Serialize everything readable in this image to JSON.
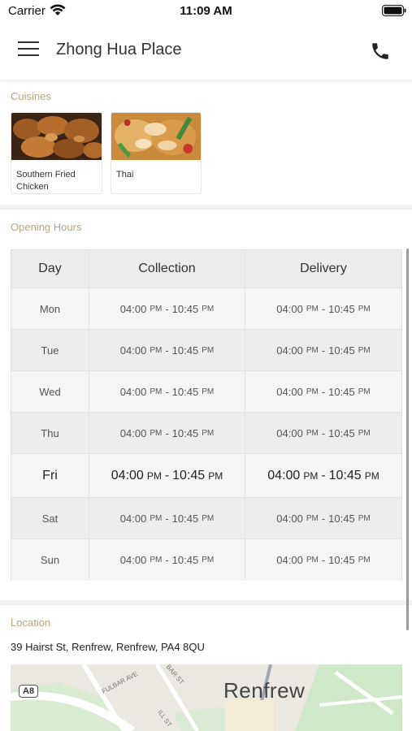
{
  "status_bar": {
    "carrier": "Carrier",
    "time": "11:09 AM"
  },
  "header": {
    "title": "Zhong Hua Place"
  },
  "cuisines": {
    "label": "Cuisines",
    "items": [
      {
        "name": "Southern Fried Chicken"
      },
      {
        "name": "Thai"
      }
    ]
  },
  "opening_hours": {
    "label": "Opening Hours",
    "columns": [
      "Day",
      "Collection",
      "Delivery"
    ],
    "rows": [
      {
        "day": "Mon",
        "collection": {
          "open": "04:00",
          "close": "10:45"
        },
        "delivery": {
          "open": "04:00",
          "close": "10:45"
        }
      },
      {
        "day": "Tue",
        "collection": {
          "open": "04:00",
          "close": "10:45"
        },
        "delivery": {
          "open": "04:00",
          "close": "10:45"
        }
      },
      {
        "day": "Wed",
        "collection": {
          "open": "04:00",
          "close": "10:45"
        },
        "delivery": {
          "open": "04:00",
          "close": "10:45"
        }
      },
      {
        "day": "Thu",
        "collection": {
          "open": "04:00",
          "close": "10:45"
        },
        "delivery": {
          "open": "04:00",
          "close": "10:45"
        }
      },
      {
        "day": "Fri",
        "collection": {
          "open": "04:00",
          "close": "10:45"
        },
        "delivery": {
          "open": "04:00",
          "close": "10:45"
        }
      },
      {
        "day": "Sat",
        "collection": {
          "open": "04:00",
          "close": "10:45"
        },
        "delivery": {
          "open": "04:00",
          "close": "10:45"
        }
      },
      {
        "day": "Sun",
        "collection": {
          "open": "04:00",
          "close": "10:45"
        },
        "delivery": {
          "open": "04:00",
          "close": "10:45"
        }
      }
    ],
    "pm_suffix": "PM",
    "separator": "-"
  },
  "location": {
    "label": "Location",
    "address": "39 Hairst St, Renfrew, Renfrew, PA4 8QU",
    "map": {
      "town": "Renfrew",
      "road_badge": "A8",
      "streets": [
        "FULBAR AVE",
        "BAR ST",
        "ILL ST"
      ]
    }
  },
  "colors": {
    "section_label": "#b3a77a",
    "divider": "#f0f0f0"
  }
}
